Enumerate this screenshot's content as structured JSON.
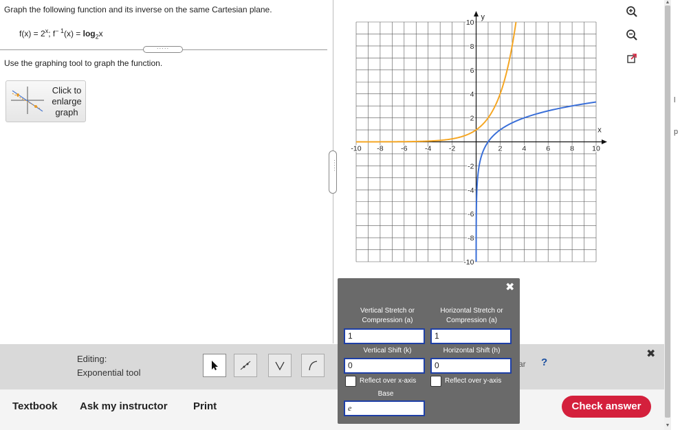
{
  "question": {
    "prompt": "Graph the following function and its inverse on the same Cartesian plane.",
    "f_label": "f(x) = 2",
    "f_exp": "x",
    "sep": "; f",
    "inv_exp": "− 1",
    "inv_label": "(x) = ",
    "log_word": "log",
    "log_base": "2",
    "log_arg": "x",
    "divider_dots": "·····",
    "instruction": "Use the graphing tool to graph the function."
  },
  "enlarge": {
    "line1": "Click to",
    "line2": "enlarge",
    "line3": "graph"
  },
  "split_dots": "·····",
  "right_icons": [
    "zoom-in-icon",
    "zoom-out-icon",
    "popout-icon"
  ],
  "graph": {
    "x_range": [
      -10,
      10
    ],
    "y_range": [
      -10,
      10
    ],
    "x_ticks": [
      "-10",
      "-8",
      "-6",
      "-4",
      "-2",
      "2",
      "4",
      "6",
      "8",
      "10"
    ],
    "y_ticks": [
      "10",
      "8",
      "6",
      "4",
      "2",
      "-2",
      "-4",
      "-6",
      "-8",
      "-10"
    ],
    "x_axis_label": "x",
    "y_axis_label": "y",
    "exp_color": "#f5a623",
    "log_color": "#3a6fd8"
  },
  "panel": {
    "vstretch_label_1": "Vertical Stretch or",
    "vstretch_label_2": "Compression (a)",
    "hstretch_label_1": "Horizontal Stretch or",
    "hstretch_label_2": "Compression (a)",
    "vstretch_value": "1",
    "hstretch_value": "1",
    "vshift_label": "Vertical Shift (k)",
    "hshift_label": "Horizontal Shift (h)",
    "vshift_value": "0",
    "hshift_value": "0",
    "reflect_x": "Reflect over x-axis",
    "reflect_y": "Reflect over y-axis",
    "base_label": "Base",
    "base_value": "e"
  },
  "toolbar": {
    "editing_label": "Editing:",
    "tool_name": "Exponential tool",
    "frag": "ar",
    "help": "?"
  },
  "bottom": {
    "textbook": "Textbook",
    "ask": "Ask my instructor",
    "print": "Print",
    "check": "Check answer"
  },
  "edge_fragments": [
    "l",
    "p"
  ]
}
